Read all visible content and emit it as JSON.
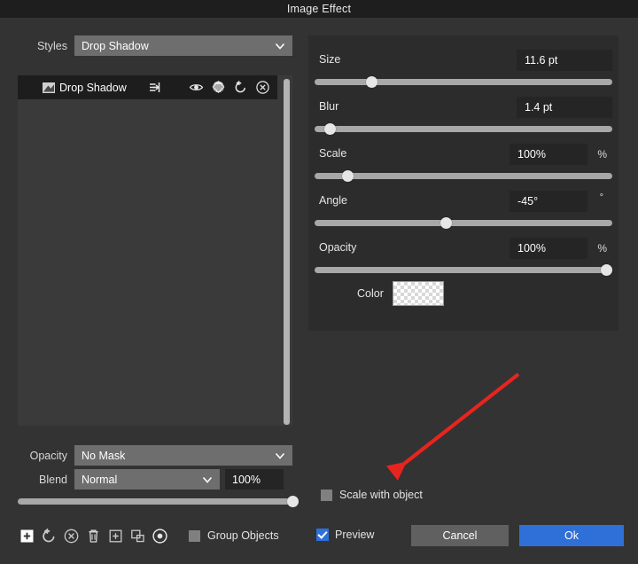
{
  "window": {
    "title": "Image Effect"
  },
  "left": {
    "styles": {
      "label": "Styles",
      "value": "Drop Shadow",
      "chevron_icon": "chevron-down-icon"
    },
    "layer": {
      "name": "Drop Shadow",
      "thumbnail_icon": "image-thumbnail-icon",
      "icons": [
        {
          "name": "enter-arrow-icon"
        },
        {
          "name": "eye-icon"
        },
        {
          "name": "layers-stack-icon"
        },
        {
          "name": "reset-icon"
        },
        {
          "name": "close-circle-icon"
        }
      ]
    },
    "opacity": {
      "label": "Opacity",
      "value": "No Mask",
      "chevron_icon": "chevron-down-icon"
    },
    "blend": {
      "label": "Blend",
      "value": "Normal",
      "amount": "100%",
      "chevron_icon": "chevron-down-icon",
      "slider_percent": 100
    },
    "toolbar": {
      "icons": [
        {
          "name": "add-icon"
        },
        {
          "name": "reset-icon"
        },
        {
          "name": "close-circle-icon"
        },
        {
          "name": "trash-icon"
        },
        {
          "name": "duplicate-icon"
        },
        {
          "name": "copy-shapes-icon"
        },
        {
          "name": "record-target-icon"
        }
      ],
      "group_objects": {
        "label": "Group Objects",
        "checked": false
      }
    }
  },
  "right": {
    "properties": [
      {
        "label": "Size",
        "value": "11.6 pt",
        "unit": "",
        "slider_percent": 19
      },
      {
        "label": "Blur",
        "value": "1.4 pt",
        "unit": "",
        "slider_percent": 5
      },
      {
        "label": "Scale",
        "value": "100%",
        "unit": "%",
        "slider_percent": 11
      },
      {
        "label": "Angle",
        "value": "-45°",
        "unit": "°",
        "slider_percent": 44
      },
      {
        "label": "Opacity",
        "value": "100%",
        "unit": "%",
        "slider_percent": 98
      }
    ],
    "color": {
      "label": "Color",
      "value": "transparent"
    }
  },
  "footer": {
    "scale_with_object": {
      "label": "Scale with object",
      "checked": false
    },
    "preview": {
      "label": "Preview",
      "checked": true
    },
    "cancel_label": "Cancel",
    "ok_label": "Ok"
  },
  "annotation": {
    "arrow_color": "#e8241f",
    "points_to": "scale-with-object-checkbox"
  },
  "colors": {
    "window_bg": "#333333",
    "titlebar_bg": "#1e1e1e",
    "panel_bg": "#2c2c2c",
    "field_bg": "#252525",
    "combo_bg": "#6e6e6e",
    "accent": "#2f6fd8",
    "slider_track": "#a8a8a8"
  }
}
